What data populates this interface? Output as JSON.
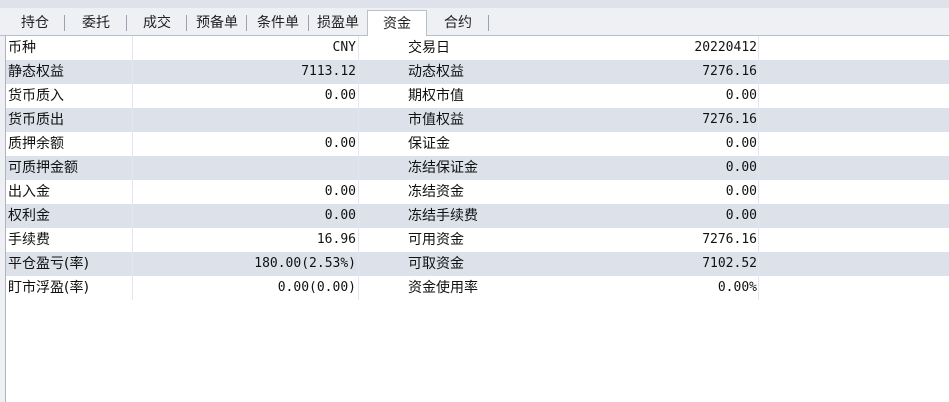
{
  "tabs": [
    {
      "label": "持仓",
      "active": false
    },
    {
      "label": "委托",
      "active": false
    },
    {
      "label": "成交",
      "active": false
    },
    {
      "label": "预备单",
      "active": false
    },
    {
      "label": "条件单",
      "active": false
    },
    {
      "label": "损盈单",
      "active": false
    },
    {
      "label": "资金",
      "active": true
    },
    {
      "label": "合约",
      "active": false
    }
  ],
  "fund_table": {
    "rows": [
      {
        "label_left": "币种",
        "value_left": "CNY",
        "label_right": "交易日",
        "value_right": "20220412"
      },
      {
        "label_left": "静态权益",
        "value_left": "7113.12",
        "label_right": "动态权益",
        "value_right": "7276.16"
      },
      {
        "label_left": "货币质入",
        "value_left": "0.00",
        "label_right": "期权市值",
        "value_right": "0.00"
      },
      {
        "label_left": "货币质出",
        "value_left": "",
        "label_right": "市值权益",
        "value_right": "7276.16"
      },
      {
        "label_left": "质押余额",
        "value_left": "0.00",
        "label_right": "保证金",
        "value_right": "0.00"
      },
      {
        "label_left": "可质押金额",
        "value_left": "",
        "label_right": "冻结保证金",
        "value_right": "0.00"
      },
      {
        "label_left": "出入金",
        "value_left": "0.00",
        "label_right": "冻结资金",
        "value_right": "0.00"
      },
      {
        "label_left": "权利金",
        "value_left": "0.00",
        "label_right": "冻结手续费",
        "value_right": "0.00"
      },
      {
        "label_left": "手续费",
        "value_left": "16.96",
        "label_right": "可用资金",
        "value_right": "7276.16"
      },
      {
        "label_left": "平仓盈亏(率)",
        "value_left": "180.00(2.53%)",
        "label_right": "可取资金",
        "value_right": "7102.52"
      },
      {
        "label_left": "盯市浮盈(率)",
        "value_left": "0.00(0.00)",
        "label_right": "资金使用率",
        "value_right": "0.00%"
      }
    ]
  }
}
